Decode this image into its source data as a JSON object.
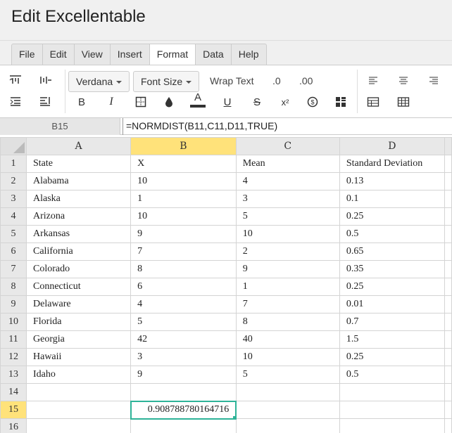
{
  "app": {
    "title": "Edit Excellentable"
  },
  "menu": {
    "items": [
      {
        "id": "file",
        "label": "File"
      },
      {
        "id": "edit",
        "label": "Edit"
      },
      {
        "id": "view",
        "label": "View"
      },
      {
        "id": "insert",
        "label": "Insert"
      },
      {
        "id": "format",
        "label": "Format",
        "active": true
      },
      {
        "id": "data",
        "label": "Data"
      },
      {
        "id": "help",
        "label": "Help"
      }
    ]
  },
  "toolbar": {
    "font_family": "Verdana",
    "font_size": "Font Size",
    "wrap_text": "Wrap Text",
    "decrease_decimal": ".0",
    "increase_decimal": ".00",
    "bold": "B",
    "italic": "I",
    "text_color_glyph": "A",
    "underline": "U",
    "strikethrough": "S",
    "superscript": "x²",
    "icons": [
      "align-top-icon",
      "align-middle-vertical-icon",
      "align-left-icon",
      "align-center-icon",
      "align-right-icon",
      "indent-icon",
      "outdent-icon",
      "borders-icon",
      "fill-color-icon",
      "currency-icon",
      "conditional-format-icon",
      "table-icon",
      "table-style-icon"
    ]
  },
  "formula_bar": {
    "cell_ref": "B15",
    "formula": "=NORMDIST(B11,C11,D11,TRUE)"
  },
  "sheet": {
    "columns": [
      "A",
      "B",
      "C",
      "D"
    ],
    "selected_column": "B",
    "selected_row": "15",
    "rows": [
      {
        "num": "1",
        "cells": [
          "State",
          "X",
          "Mean",
          "Standard Deviation"
        ]
      },
      {
        "num": "2",
        "cells": [
          "Alabama",
          "10",
          "4",
          "0.13"
        ]
      },
      {
        "num": "3",
        "cells": [
          "Alaska",
          "1",
          "3",
          "0.1"
        ]
      },
      {
        "num": "4",
        "cells": [
          "Arizona",
          "10",
          "5",
          "0.25"
        ]
      },
      {
        "num": "5",
        "cells": [
          "Arkansas",
          "9",
          "10",
          "0.5"
        ]
      },
      {
        "num": "6",
        "cells": [
          "California",
          "7",
          "2",
          "0.65"
        ]
      },
      {
        "num": "7",
        "cells": [
          "Colorado",
          "8",
          "9",
          "0.35"
        ]
      },
      {
        "num": "8",
        "cells": [
          "Connecticut",
          "6",
          "1",
          "0.25"
        ]
      },
      {
        "num": "9",
        "cells": [
          "Delaware",
          "4",
          "7",
          "0.01"
        ]
      },
      {
        "num": "10",
        "cells": [
          "Florida",
          "5",
          "8",
          "0.7"
        ]
      },
      {
        "num": "11",
        "cells": [
          "Georgia",
          "42",
          "40",
          "1.5"
        ]
      },
      {
        "num": "12",
        "cells": [
          "Hawaii",
          "3",
          "10",
          "0.25"
        ]
      },
      {
        "num": "13",
        "cells": [
          "Idaho",
          "9",
          "5",
          "0.5"
        ]
      },
      {
        "num": "14",
        "cells": [
          "",
          "",
          "",
          ""
        ]
      },
      {
        "num": "15",
        "cells": [
          "",
          "0.908788780164716",
          "",
          ""
        ]
      },
      {
        "num": "16",
        "cells": [
          "",
          "",
          "",
          ""
        ]
      }
    ]
  },
  "colors": {
    "accent": "#2eb398",
    "selected_header": "#ffe27a"
  }
}
